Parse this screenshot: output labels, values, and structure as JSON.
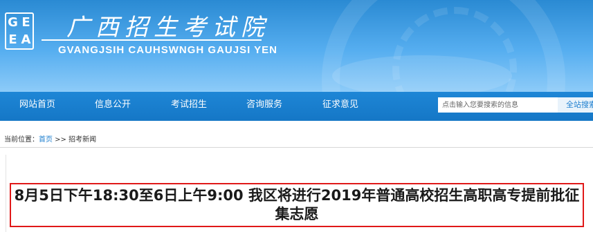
{
  "header": {
    "logo_letters": [
      "G",
      "E",
      "E",
      "A"
    ],
    "title": "广西招生考试院",
    "subtitle": "GVANGJSIH CAUHSWNGH GAUJSI YEN"
  },
  "nav": {
    "items": [
      {
        "label": "网站首页"
      },
      {
        "label": "信息公开"
      },
      {
        "label": "考试招生"
      },
      {
        "label": "咨询服务"
      },
      {
        "label": "征求意见"
      }
    ],
    "search_placeholder": "点击输入您要搜索的信息",
    "search_button": "全站搜索"
  },
  "breadcrumb": {
    "prefix": "当前位置：",
    "home": "首页",
    "sep": " >> ",
    "current": "招考新闻"
  },
  "article": {
    "headline": "8月5日下午18:30至6日上午9:00 我区将进行2019年普通高校招生高职高专提前批征集志愿"
  },
  "colors": {
    "nav_bg": "#1a7fcf",
    "header_bg": "#4aa6ea",
    "headline_border": "#e01818",
    "link": "#1e7fcf"
  }
}
